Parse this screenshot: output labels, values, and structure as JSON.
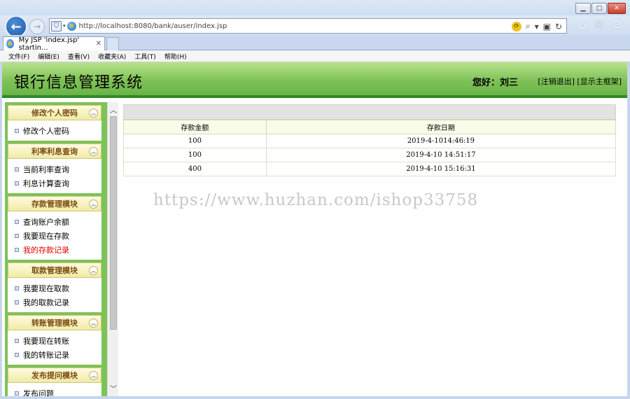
{
  "browser": {
    "url": "http://localhost:8080/bank/auser/index.jsp",
    "tab_title": "My JSP 'index.jsp' startin...",
    "menu": [
      "文件(F)",
      "编辑(E)",
      "查看(V)",
      "收藏夹(A)",
      "工具(T)",
      "帮助(H)"
    ],
    "icons": [
      "back-icon",
      "forward-icon",
      "search-icon",
      "refresh-icon",
      "home-icon",
      "favorites-star-icon",
      "gear-icon"
    ]
  },
  "header": {
    "title": "银行信息管理系统",
    "welcome": "您好：刘三",
    "logout_link": "[注销退出]",
    "show_frame_link": "[显示主框架]"
  },
  "sidebar": {
    "groups": [
      {
        "title": "修改个人密码",
        "items": [
          {
            "label": "修改个人密码"
          }
        ]
      },
      {
        "title": "利率利息查询",
        "items": [
          {
            "label": "当前利率查询"
          },
          {
            "label": "利息计算查询"
          }
        ]
      },
      {
        "title": "存款管理模块",
        "items": [
          {
            "label": "查询账户余额"
          },
          {
            "label": "我要现在存款"
          },
          {
            "label": "我的存款记录",
            "active": true
          }
        ]
      },
      {
        "title": "取款管理模块",
        "items": [
          {
            "label": "我要现在取款"
          },
          {
            "label": "我的取款记录"
          }
        ]
      },
      {
        "title": "转账管理模块",
        "items": [
          {
            "label": "我要现在转账"
          },
          {
            "label": "我的转账记录"
          }
        ]
      },
      {
        "title": "发布提问模块",
        "items": [
          {
            "label": "发布问题"
          }
        ]
      }
    ]
  },
  "deposit_table": {
    "columns": [
      "存款金额",
      "存款日期"
    ],
    "rows": [
      [
        "100",
        "2019-4-1014:46:19"
      ],
      [
        "100",
        "2019-4-10 14:51:17"
      ],
      [
        "400",
        "2019-4-10 15:16:31"
      ]
    ]
  },
  "watermark": "https://www.huzhan.com/ishop33758",
  "colors": {
    "header_green": "#7fc257",
    "header_border": "#2f8a26",
    "group_title": "#7a4c12",
    "active_link": "#e00000"
  }
}
